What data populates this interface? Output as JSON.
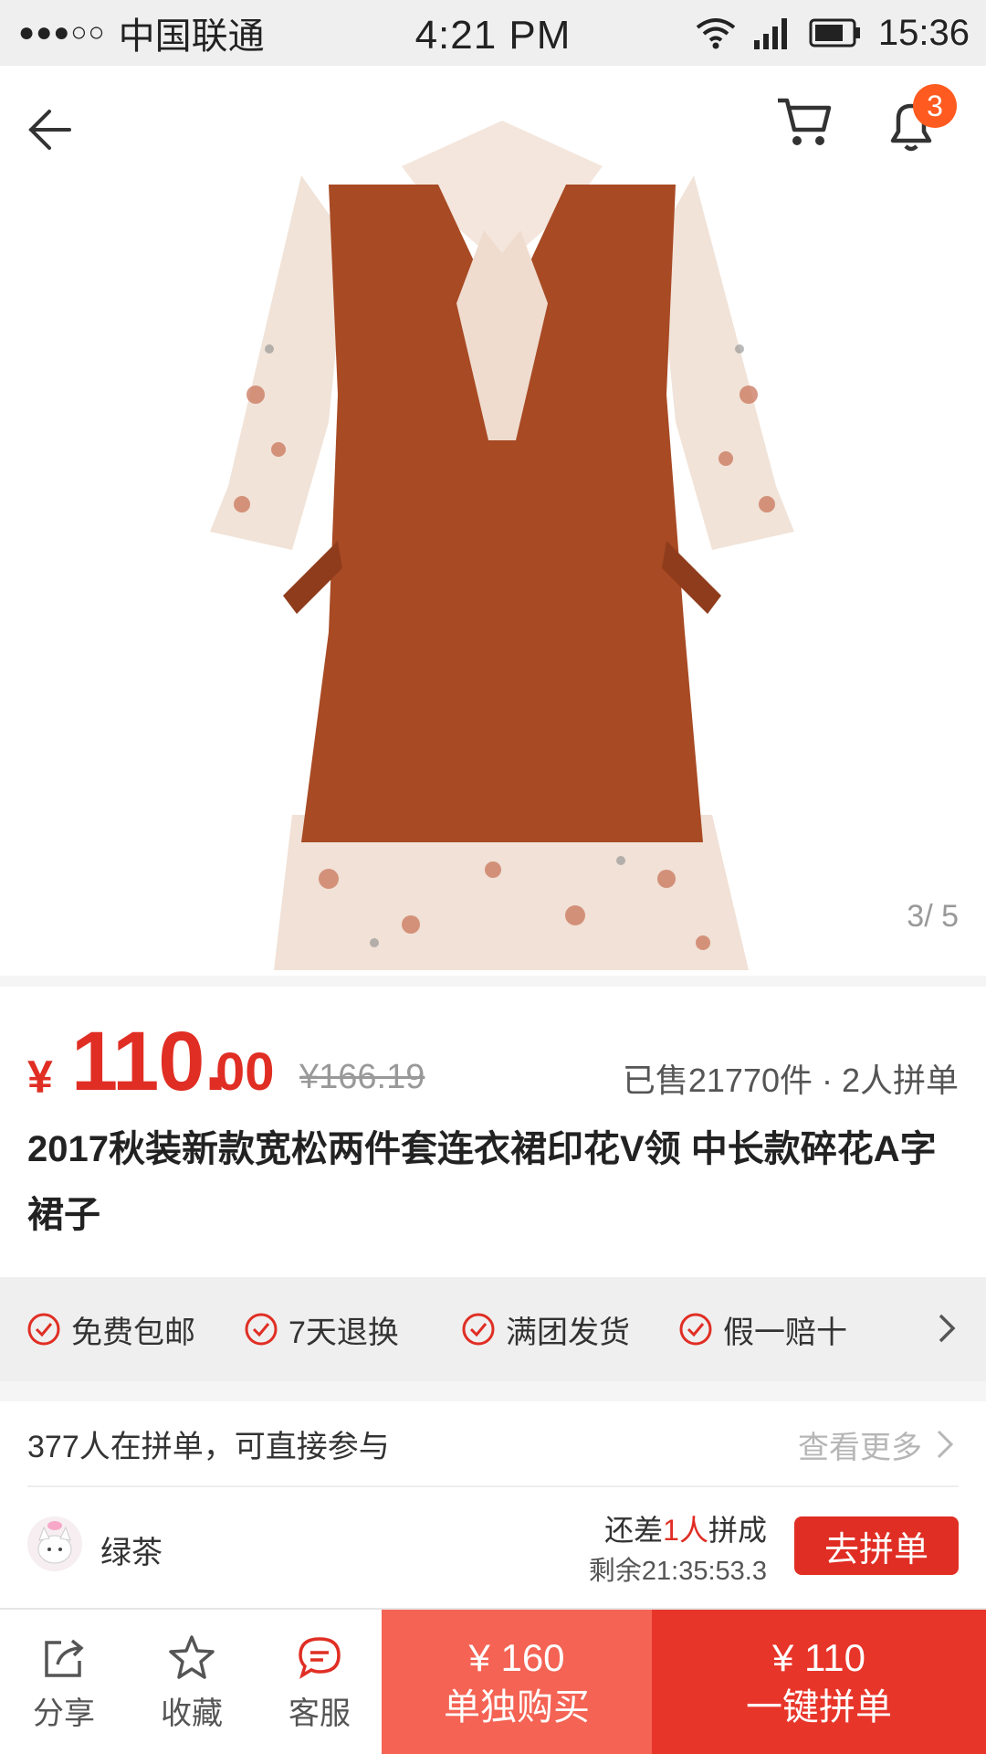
{
  "status_bar": {
    "signal_dots": "●●●○○",
    "carrier": "中国联通",
    "time_center": "4:21 PM",
    "time_right": "15:36"
  },
  "nav": {
    "notification_count": "3",
    "image_counter": "3/ 5"
  },
  "price": {
    "symbol": "¥",
    "integer": "110.",
    "decimal": "00",
    "original": "¥166.19",
    "sold": "已售21770件 · 2人拼单"
  },
  "product": {
    "title": "2017秋装新款宽松两件套连衣裙印花V领 中长款碎花A字裙子"
  },
  "services": {
    "items": [
      "免费包邮",
      "7天退换",
      "满团发货",
      "假一赔十"
    ]
  },
  "group": {
    "header": "377人在拼单，可直接参与",
    "see_more": "查看更多",
    "user_name": "绿茶",
    "need_prefix": "还差",
    "need_count": "1人",
    "need_suffix": "拼成",
    "remaining": "剩余21:35:53.3",
    "join_label": "去拼单"
  },
  "bottom_bar": {
    "share": "分享",
    "favorite": "收藏",
    "service": "客服",
    "alone_price": "¥ 160",
    "alone_label": "单独购买",
    "group_price": "¥ 110",
    "group_label": "一键拼单"
  },
  "colors": {
    "accent_red": "#e02e24",
    "buy_alone_bg": "#f46354",
    "buy_group_bg": "#e8352a",
    "badge_orange": "#ff5a1f"
  }
}
